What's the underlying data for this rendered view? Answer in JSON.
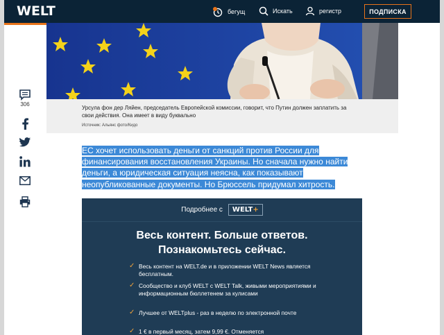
{
  "header": {
    "logo": "WELT",
    "notification_label": "бегущ",
    "search_label": "Искать",
    "register_label": "регистр",
    "subscribe_label": "ПОДПИСКА",
    "accent_color": "#e8731a",
    "bg_color": "#0b2336"
  },
  "article": {
    "caption": "Урсула фон дер Ляйен, председатель Европейской комиссии, говорит, что Путин должен заплатить за свои действия. Она имеет в виду буквально",
    "credit": "Источник: Альянс фото/Кидо",
    "lead": "ЕС хочет использовать деньги от санкций против России для финансирования восстановления Украины. Но сначала нужно найти деньги, а юридическая ситуация неясна, как показывают неопубликованные документы. Но Брюссель придумал хитрость."
  },
  "social": {
    "comment_count": "306",
    "icons": [
      "comment-icon",
      "facebook-icon",
      "twitter-icon",
      "linkedin-icon",
      "email-icon",
      "print-icon"
    ]
  },
  "promo": {
    "more_label": "Подробнее с",
    "brand": "WELT",
    "brand_plus": "+",
    "headline_1": "Весь контент. Больше ответов.",
    "headline_2": "Познакомьтесь сейчас.",
    "features": [
      "Весь контент на WELT.de и в приложении WELT News является бесплатным.",
      "Сообщество и клуб WELT с WELT Talk, живыми мероприятиями и информационным бюллетенем за кулисами",
      "Лучшее от WELTplus - раз в неделю по электронной почте",
      "1 € в первый месяц, затем 9,99 €. Отменяется"
    ]
  }
}
